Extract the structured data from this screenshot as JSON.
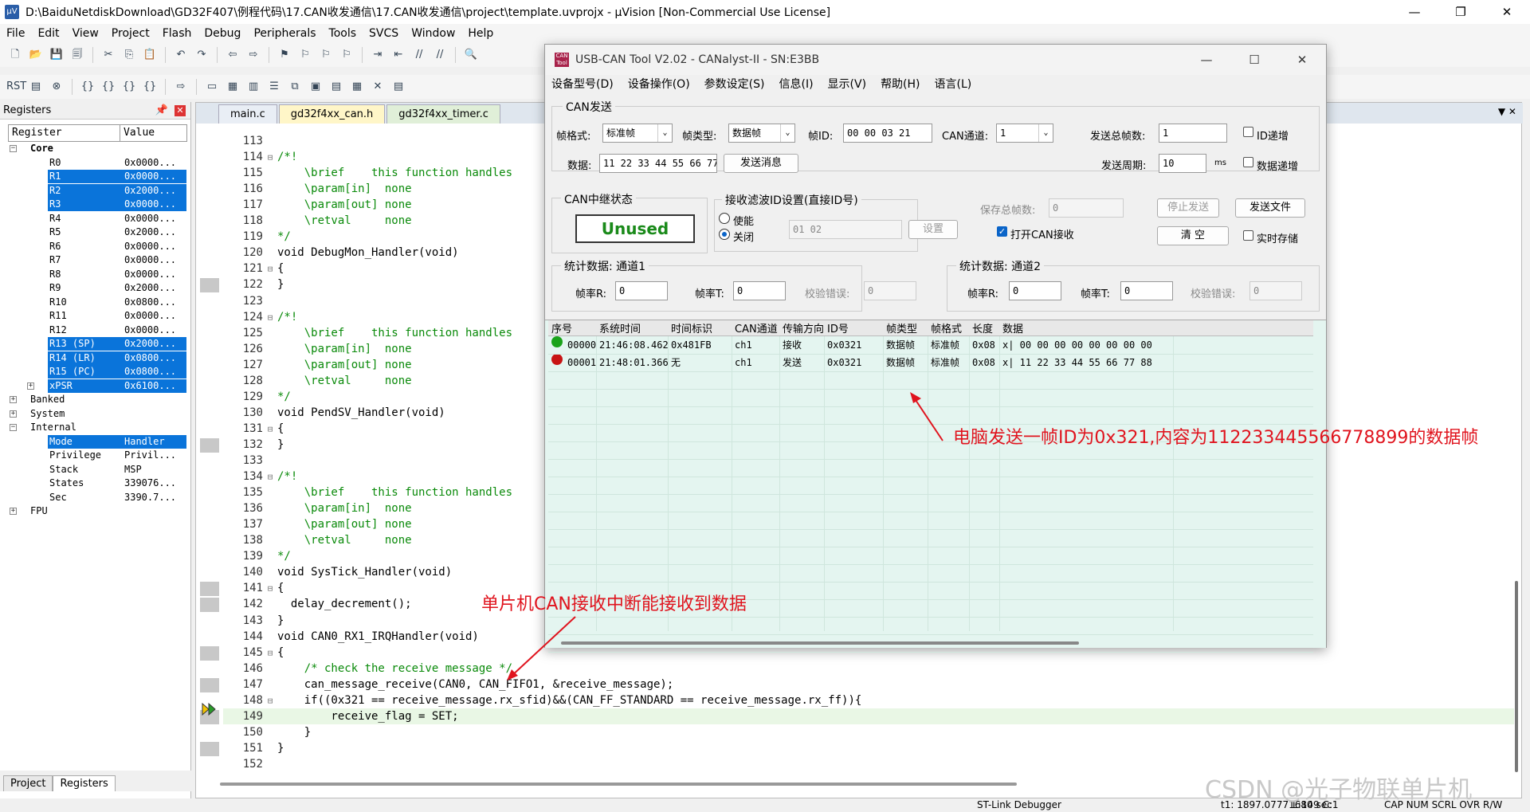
{
  "window": {
    "title": "D:\\BaiduNetdiskDownload\\GD32F407\\例程代码\\17.CAN收发通信\\17.CAN收发通信\\project\\template.uvprojx - µVision  [Non-Commercial Use License]",
    "controls": [
      "—",
      "❐",
      "✕"
    ]
  },
  "menu": [
    "File",
    "Edit",
    "View",
    "Project",
    "Flash",
    "Debug",
    "Peripherals",
    "Tools",
    "SVCS",
    "Window",
    "Help"
  ],
  "registers": {
    "title": "Registers",
    "col_register": "Register",
    "col_value": "Value",
    "rows": [
      {
        "name": "Core",
        "value": "",
        "level": 1,
        "bold": true,
        "selected": false,
        "tree": "−"
      },
      {
        "name": "R0",
        "value": "0x0000...",
        "level": 2,
        "selected": false
      },
      {
        "name": "R1",
        "value": "0x0000...",
        "level": 2,
        "selected": true
      },
      {
        "name": "R2",
        "value": "0x2000...",
        "level": 2,
        "selected": true
      },
      {
        "name": "R3",
        "value": "0x0000...",
        "level": 2,
        "selected": true
      },
      {
        "name": "R4",
        "value": "0x0000...",
        "level": 2,
        "selected": false
      },
      {
        "name": "R5",
        "value": "0x2000...",
        "level": 2,
        "selected": false
      },
      {
        "name": "R6",
        "value": "0x0000...",
        "level": 2,
        "selected": false
      },
      {
        "name": "R7",
        "value": "0x0000...",
        "level": 2,
        "selected": false
      },
      {
        "name": "R8",
        "value": "0x0000...",
        "level": 2,
        "selected": false
      },
      {
        "name": "R9",
        "value": "0x2000...",
        "level": 2,
        "selected": false
      },
      {
        "name": "R10",
        "value": "0x0800...",
        "level": 2,
        "selected": false
      },
      {
        "name": "R11",
        "value": "0x0000...",
        "level": 2,
        "selected": false
      },
      {
        "name": "R12",
        "value": "0x0000...",
        "level": 2,
        "selected": false
      },
      {
        "name": "R13 (SP)",
        "value": "0x2000...",
        "level": 2,
        "selected": true
      },
      {
        "name": "R14 (LR)",
        "value": "0x0800...",
        "level": 2,
        "selected": true
      },
      {
        "name": "R15 (PC)",
        "value": "0x0800...",
        "level": 2,
        "selected": true
      },
      {
        "name": "xPSR",
        "value": "0x6100...",
        "level": 2,
        "selected": true,
        "tree": "+"
      },
      {
        "name": "Banked",
        "value": "",
        "level": 1,
        "selected": false,
        "tree": "+"
      },
      {
        "name": "System",
        "value": "",
        "level": 1,
        "selected": false,
        "tree": "+"
      },
      {
        "name": "Internal",
        "value": "",
        "level": 1,
        "selected": false,
        "tree": "−"
      },
      {
        "name": "Mode",
        "value": "Handler",
        "level": 2,
        "selected": true
      },
      {
        "name": "Privilege",
        "value": "Privil...",
        "level": 2,
        "selected": false
      },
      {
        "name": "Stack",
        "value": "MSP",
        "level": 2,
        "selected": false
      },
      {
        "name": "States",
        "value": "339076...",
        "level": 2,
        "selected": false
      },
      {
        "name": "Sec",
        "value": "3390.7...",
        "level": 2,
        "selected": false
      },
      {
        "name": "FPU",
        "value": "",
        "level": 1,
        "selected": false,
        "tree": "+"
      }
    ]
  },
  "bottom_tabs": [
    "Project",
    "Registers"
  ],
  "editor_tabs": [
    "main.c",
    "gd32f4xx_can.h",
    "gd32f4xx_timer.c"
  ],
  "code": [
    {
      "n": "113",
      "t": ""
    },
    {
      "n": "114",
      "t": "/*!",
      "c": "cmt",
      "f": "⊟"
    },
    {
      "n": "115",
      "t": "    \\brief    this function handles",
      "c": "cmt"
    },
    {
      "n": "116",
      "t": "    \\param[in]  none",
      "c": "cmt"
    },
    {
      "n": "117",
      "t": "    \\param[out] none",
      "c": "cmt"
    },
    {
      "n": "118",
      "t": "    \\retval     none",
      "c": "cmt"
    },
    {
      "n": "119",
      "t": "*/",
      "c": "cmt"
    },
    {
      "n": "120",
      "t": "void DebugMon_Handler(void)"
    },
    {
      "n": "121",
      "t": "{",
      "f": "⊟"
    },
    {
      "n": "122",
      "t": "}"
    },
    {
      "n": "123",
      "t": ""
    },
    {
      "n": "124",
      "t": "/*!",
      "c": "cmt",
      "f": "⊟"
    },
    {
      "n": "125",
      "t": "    \\brief    this function handles",
      "c": "cmt"
    },
    {
      "n": "126",
      "t": "    \\param[in]  none",
      "c": "cmt"
    },
    {
      "n": "127",
      "t": "    \\param[out] none",
      "c": "cmt"
    },
    {
      "n": "128",
      "t": "    \\retval     none",
      "c": "cmt"
    },
    {
      "n": "129",
      "t": "*/",
      "c": "cmt"
    },
    {
      "n": "130",
      "t": "void PendSV_Handler(void)"
    },
    {
      "n": "131",
      "t": "{",
      "f": "⊟"
    },
    {
      "n": "132",
      "t": "}"
    },
    {
      "n": "133",
      "t": ""
    },
    {
      "n": "134",
      "t": "/*!",
      "c": "cmt",
      "f": "⊟"
    },
    {
      "n": "135",
      "t": "    \\brief    this function handles",
      "c": "cmt"
    },
    {
      "n": "136",
      "t": "    \\param[in]  none",
      "c": "cmt"
    },
    {
      "n": "137",
      "t": "    \\param[out] none",
      "c": "cmt"
    },
    {
      "n": "138",
      "t": "    \\retval     none",
      "c": "cmt"
    },
    {
      "n": "139",
      "t": "*/",
      "c": "cmt"
    },
    {
      "n": "140",
      "t": "void SysTick_Handler(void)"
    },
    {
      "n": "141",
      "t": "{",
      "f": "⊟"
    },
    {
      "n": "142",
      "t": "  delay_decrement();"
    },
    {
      "n": "143",
      "t": "}"
    },
    {
      "n": "144",
      "t": "void CAN0_RX1_IRQHandler(void)"
    },
    {
      "n": "145",
      "t": "{",
      "f": "⊟"
    },
    {
      "n": "146",
      "t": "    /* check the receive message */",
      "c": "cmt"
    },
    {
      "n": "147",
      "t": "    can_message_receive(CAN0, CAN_FIFO1, &receive_message);"
    },
    {
      "n": "148",
      "t": "    if((0x321 == receive_message.rx_sfid)&&(CAN_FF_STANDARD == receive_message.rx_ff)){",
      "f": "⊟"
    },
    {
      "n": "149",
      "t": "        receive_flag = SET;"
    },
    {
      "n": "150",
      "t": "    }"
    },
    {
      "n": "151",
      "t": "}"
    },
    {
      "n": "152",
      "t": ""
    }
  ],
  "status": {
    "debugger": "ST-Link Debugger",
    "time": "t1: 1897.07771680 sec",
    "pos": "L:149 C:1",
    "flags": "CAP  NUM  SCRL  OVR  R/W"
  },
  "can_tool": {
    "title": "USB-CAN Tool V2.02 - CANalyst-II - SN:E3BB",
    "menu": [
      "设备型号(D)",
      "设备操作(O)",
      "参数设定(S)",
      "信息(I)",
      "显示(V)",
      "帮助(H)",
      "语言(L)"
    ],
    "send_group": "CAN发送",
    "frame_format_label": "帧格式:",
    "frame_format": "标准帧",
    "frame_type_label": "帧类型:",
    "frame_type": "数据帧",
    "frame_id_label": "帧ID:",
    "frame_id": "00 00 03 21",
    "channel_label": "CAN通道:",
    "channel": "1",
    "total_send_label": "发送总帧数:",
    "total_send": "1",
    "id_incr": "ID递增",
    "data_label": "数据:",
    "data": "11 22 33 44 55 66 77 88",
    "send_button": "发送消息",
    "period_label": "发送周期:",
    "period": "10",
    "period_unit": "ms",
    "data_incr": "数据递增",
    "relay_group": "CAN中继状态",
    "relay_status": "Unused",
    "filter_group": "接收滤波ID设置(直接ID号)",
    "filter_enable": "使能",
    "filter_disable": "关闭",
    "filter_ids": "01 02",
    "filter_set": "设置",
    "saved_total_label": "保存总帧数:",
    "saved_total": "0",
    "stop_send": "停止发送",
    "send_file": "发送文件",
    "open_can_recv": "打开CAN接收",
    "clear": "清 空",
    "realtime_save": "实时存储",
    "stats1_group": "统计数据: 通道1",
    "stats2_group": "统计数据: 通道2",
    "rx_rate_label": "帧率R:",
    "tx_rate_label": "帧率T:",
    "err_label": "校验错误:",
    "ch1_rx": "0",
    "ch1_tx": "0",
    "ch1_err": "0",
    "ch2_rx": "0",
    "ch2_tx": "0",
    "ch2_err": "0",
    "table_headers": [
      "序号",
      "系统时间",
      "时间标识",
      "CAN通道",
      "传输方向",
      "ID号",
      "帧类型",
      "帧格式",
      "长度",
      "数据"
    ],
    "rows": [
      {
        "seq": "00000",
        "time": "21:46:08.462",
        "stamp": "0x481FB",
        "ch": "ch1",
        "dir": "接收",
        "id": "0x0321",
        "type": "数据帧",
        "fmt": "标准帧",
        "len": "0x08",
        "data": "x| 00 00 00 00 00 00 00 00",
        "led": "#1aa31a"
      },
      {
        "seq": "00001",
        "time": "21:48:01.366",
        "stamp": "无",
        "ch": "ch1",
        "dir": "发送",
        "id": "0x0321",
        "type": "数据帧",
        "fmt": "标准帧",
        "len": "0x08",
        "data": "x| 11 22 33 44 55 66 77 88",
        "led": "#c81414"
      }
    ]
  },
  "annotations": {
    "pc_send": "电脑发送一帧ID为0x321,内容为1122334455667788​99的数据帧",
    "mcu_recv": "单片机CAN接收中断能接收到数据"
  },
  "watermark": "CSDN @光子物联单片机"
}
